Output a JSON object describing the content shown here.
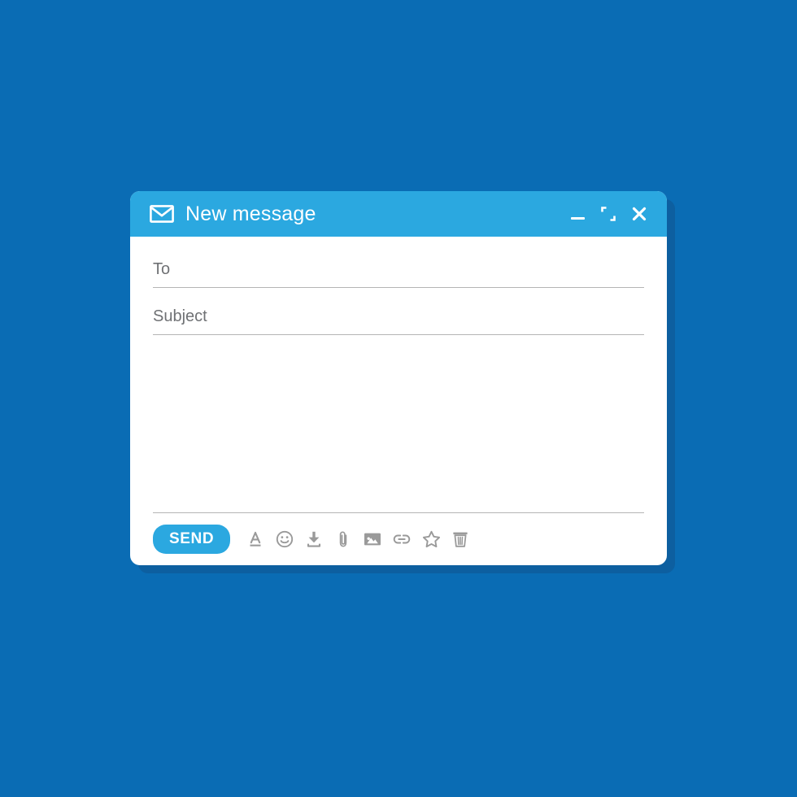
{
  "canvas": {
    "background_color": "#0a6cb4",
    "shadow_color": "#0d5fa0"
  },
  "window": {
    "accent_color": "#2ba8e0",
    "surface_color": "#ffffff",
    "title": "New message",
    "title_icon": "envelope-icon",
    "controls": [
      {
        "name": "minimize",
        "icon": "minimize-icon",
        "label": "Minimize"
      },
      {
        "name": "maximize",
        "icon": "maximize-icon",
        "label": "Maximize"
      },
      {
        "name": "close",
        "icon": "close-icon",
        "label": "Close"
      }
    ]
  },
  "fields": {
    "to": {
      "label": "To",
      "placeholder": "To",
      "value": ""
    },
    "subject": {
      "label": "Subject",
      "placeholder": "Subject",
      "value": ""
    },
    "body": {
      "placeholder": "",
      "value": ""
    }
  },
  "toolbar": {
    "send_label": "SEND",
    "send_color": "#2ba8e0",
    "icon_color": "#9a9a9a",
    "icons": [
      {
        "name": "text-format-icon",
        "label": "Text formatting"
      },
      {
        "name": "emoji-icon",
        "label": "Insert emoji"
      },
      {
        "name": "download-icon",
        "label": "Save / download"
      },
      {
        "name": "attachment-icon",
        "label": "Attach file"
      },
      {
        "name": "image-icon",
        "label": "Insert image"
      },
      {
        "name": "link-icon",
        "label": "Insert link"
      },
      {
        "name": "star-icon",
        "label": "Star"
      },
      {
        "name": "trash-icon",
        "label": "Discard"
      }
    ]
  }
}
